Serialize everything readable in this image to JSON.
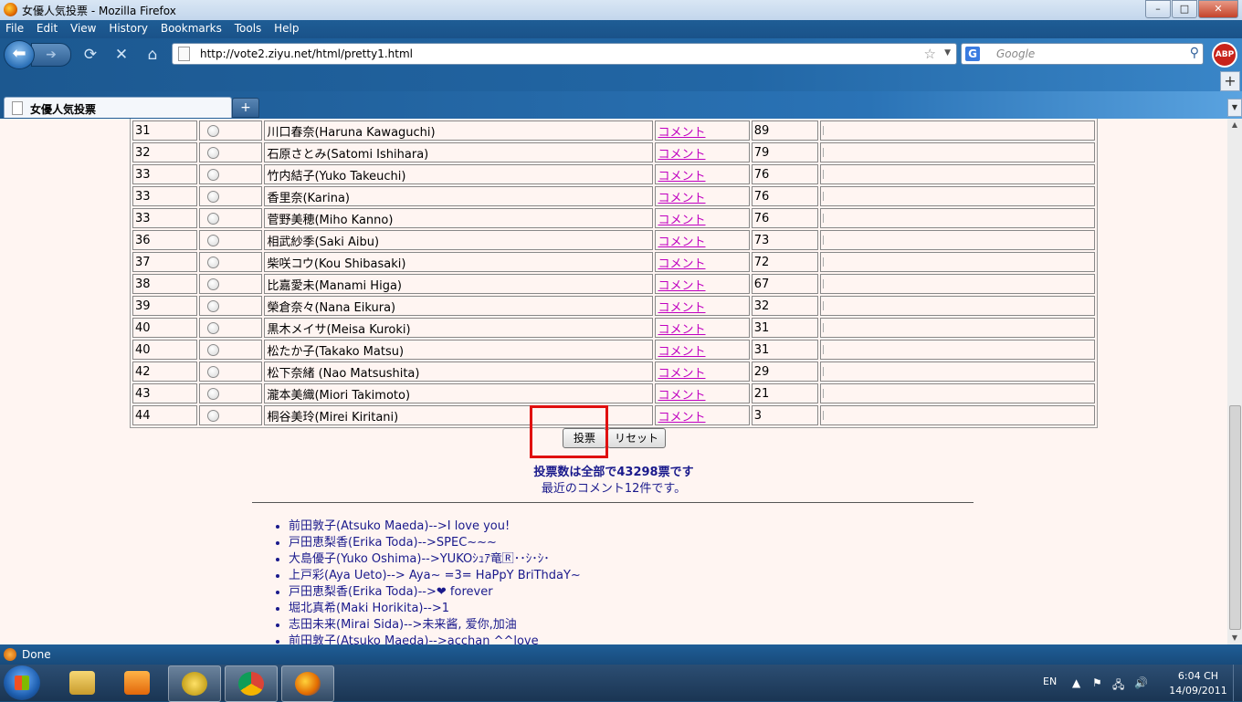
{
  "window": {
    "title": "女優人気投票 - Mozilla Firefox",
    "min": "–",
    "max": "□",
    "close": "✕"
  },
  "menu": [
    "File",
    "Edit",
    "View",
    "History",
    "Bookmarks",
    "Tools",
    "Help"
  ],
  "nav": {
    "url": "http://vote2.ziyu.net/html/pretty1.html",
    "search_placeholder": "Google",
    "abp": "ABP"
  },
  "tab": {
    "label": "女優人気投票",
    "new": "+"
  },
  "rows": [
    {
      "rank": "31",
      "name": "川口春奈(Haruna Kawaguchi)",
      "comment": "コメント",
      "votes": "89"
    },
    {
      "rank": "32",
      "name": "石原さとみ(Satomi Ishihara)",
      "comment": "コメント",
      "votes": "79"
    },
    {
      "rank": "33",
      "name": "竹内結子(Yuko Takeuchi)",
      "comment": "コメント",
      "votes": "76"
    },
    {
      "rank": "33",
      "name": "香里奈(Karina)",
      "comment": "コメント",
      "votes": "76"
    },
    {
      "rank": "33",
      "name": "菅野美穂(Miho Kanno)",
      "comment": "コメント",
      "votes": "76"
    },
    {
      "rank": "36",
      "name": "相武紗季(Saki Aibu)",
      "comment": "コメント",
      "votes": "73"
    },
    {
      "rank": "37",
      "name": "柴咲コウ(Kou Shibasaki)",
      "comment": "コメント",
      "votes": "72"
    },
    {
      "rank": "38",
      "name": "比嘉愛未(Manami Higa)",
      "comment": "コメント",
      "votes": "67"
    },
    {
      "rank": "39",
      "name": "榮倉奈々(Nana Eikura)",
      "comment": "コメント",
      "votes": "32"
    },
    {
      "rank": "40",
      "name": "黒木メイサ(Meisa Kuroki)",
      "comment": "コメント",
      "votes": "31"
    },
    {
      "rank": "40",
      "name": "松たか子(Takako Matsu)",
      "comment": "コメント",
      "votes": "31"
    },
    {
      "rank": "42",
      "name": "松下奈緒 (Nao Matsushita)",
      "comment": "コメント",
      "votes": "29"
    },
    {
      "rank": "43",
      "name": "瀧本美織(Miori Takimoto)",
      "comment": "コメント",
      "votes": "21"
    },
    {
      "rank": "44",
      "name": "桐谷美玲(Mirei Kiritani)",
      "comment": "コメント",
      "votes": "3"
    }
  ],
  "form": {
    "vote_button": "投票",
    "reset_button": "リセット"
  },
  "summary": {
    "total": "投票数は全部で43298票です",
    "recent": "最近のコメント12件です。"
  },
  "comments": [
    "前田敦子(Atsuko Maeda)-->I love you!",
    "戸田恵梨香(Erika Toda)-->SPEC~~~",
    "大島優子(Yuko Oshima)-->YUKOｼｭｱ竜🅁･･ｼ･ｼ･",
    "上戸彩(Aya Ueto)--> Aya~ =3= HaPpY BriThdaY~",
    "戸田恵梨香(Erika Toda)-->❤ forever",
    "堀北真希(Maki Horikita)-->1",
    "志田未来(Mirai Sida)-->未来酱, 爱你,加油",
    "前田敦子(Atsuko Maeda)-->acchan ^^love"
  ],
  "status": {
    "text": "Done"
  },
  "taskbar": {
    "lang": "EN",
    "time": "6:04 CH",
    "date": "14/09/2011"
  }
}
